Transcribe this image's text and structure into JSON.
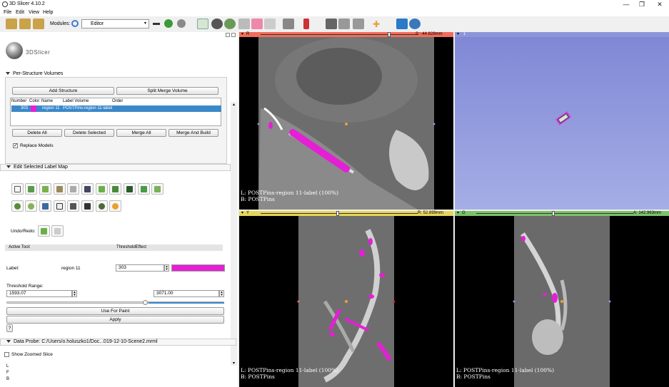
{
  "window": {
    "title": "3D Slicer 4.10.2",
    "min": "—",
    "max": "❐",
    "close": "✕"
  },
  "menu": [
    "File",
    "Edit",
    "View",
    "Help"
  ],
  "toolbar": {
    "modules_label": "Modules:",
    "module_selected": "Editor"
  },
  "logo_text": "3DSlicer",
  "per_structure": {
    "title": "Per-Structure Volumes",
    "add_structure": "Add Structure",
    "split_merge": "Split Merge Volume",
    "columns": [
      "Number",
      "Color",
      "Name",
      "Label Volume",
      "Order"
    ],
    "rows": [
      {
        "number": "303",
        "color": "#e51fd6",
        "name": "region 11",
        "label_volume": "POSTPins-region 11-label",
        "order": ""
      }
    ],
    "buttons": [
      "Delete All",
      "Delete Selected",
      "Merge All",
      "Merge And Build"
    ],
    "replace_models": "Replace Models"
  },
  "edit_label_map": {
    "title": "Edit Selected Label Map",
    "undo_redo": "Undo/Redo:",
    "active_tool_label": "Active Tool:",
    "active_tool_value": "ThresholdEffect",
    "label_label": "Label:",
    "label_name": "region 11",
    "label_value": "303",
    "label_color": "#e51fd6",
    "threshold_label": "Threshold Range:",
    "threshold_min": "1593.07",
    "threshold_max": "3071.00",
    "use_for_paint": "Use For Paint",
    "apply": "Apply",
    "help": "?"
  },
  "data_probe": {
    "title": "Data Probe: C:/Users/o.holuszko1/Doc...019-12-10-Scene2.mrml",
    "show_zoomed": "Show Zoomed Slice",
    "lines": [
      "L",
      "F",
      "B"
    ]
  },
  "views": {
    "red": {
      "letter": "R",
      "offset": "S: -44.828mm",
      "color": "#f26d5b",
      "labels": [
        "L: POSTPins-region 11-label (100%)",
        "B: POSTPins"
      ]
    },
    "threeD": {
      "letter": "1",
      "color": "#8c95d8"
    },
    "yellow": {
      "letter": "Y",
      "offset": "R: 52.899mm",
      "color": "#e8d65b",
      "labels": [
        "L: POSTPins-region 11-label (100%)",
        "B: POSTPins"
      ]
    },
    "green": {
      "letter": "G",
      "offset": "A: 142.963mm",
      "color": "#7cc36a",
      "labels": [
        "L: POSTPins-region 11-label (100%)",
        "B: POSTPins"
      ]
    }
  }
}
